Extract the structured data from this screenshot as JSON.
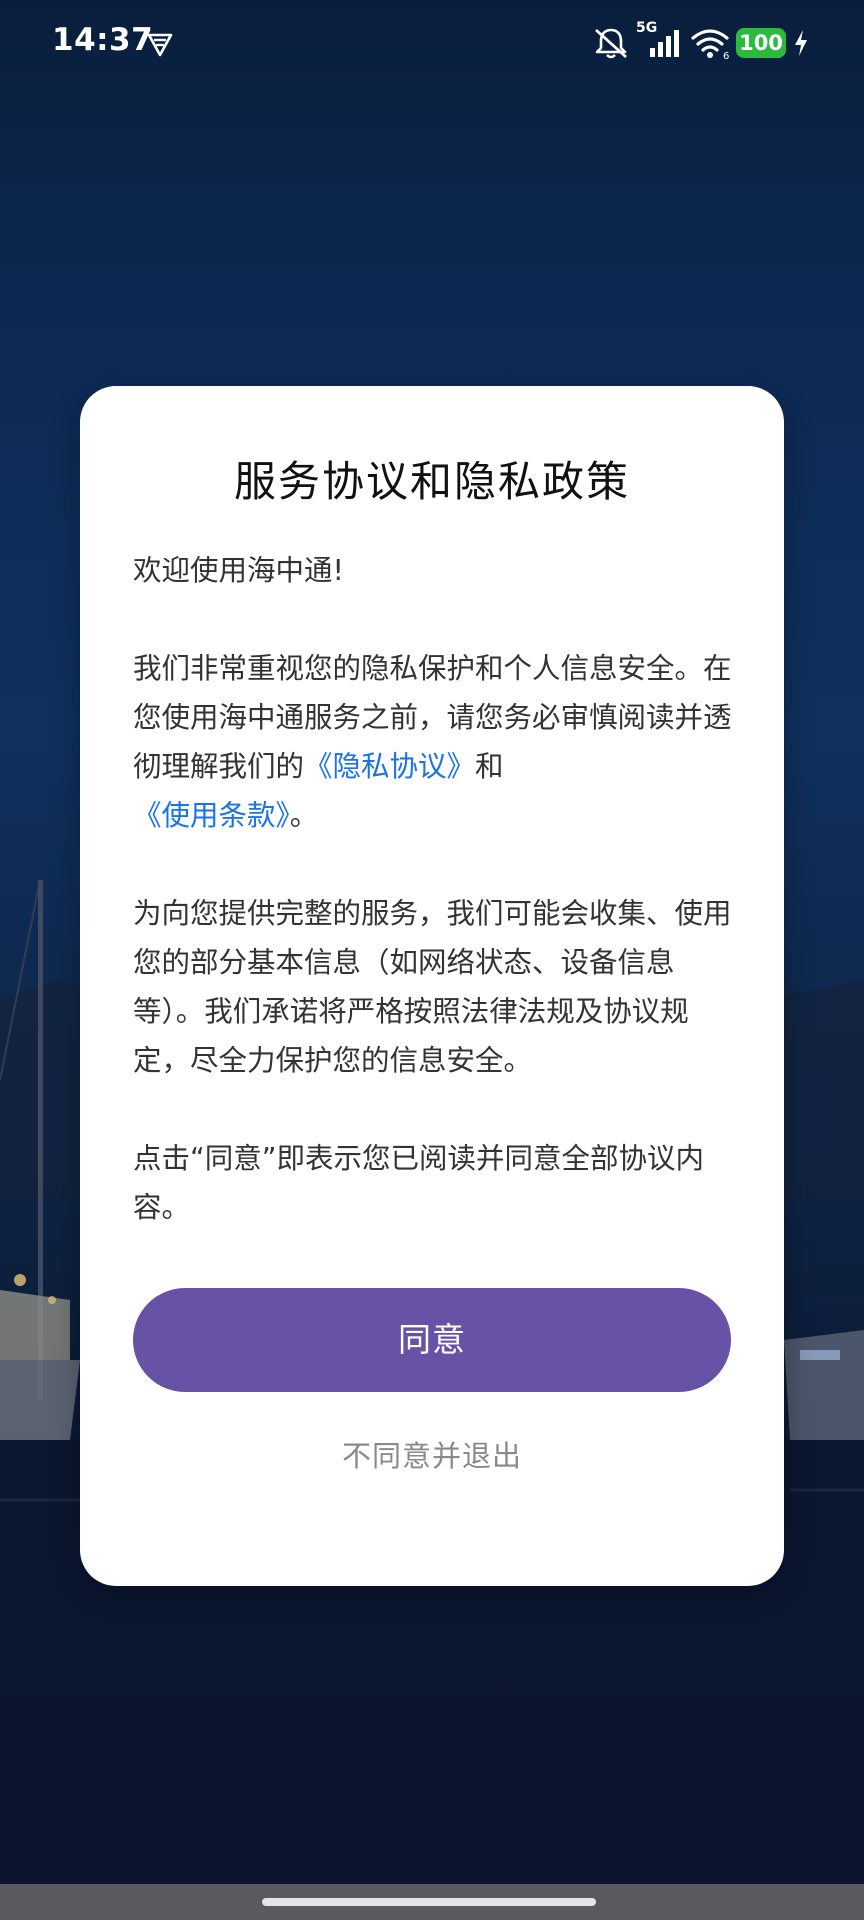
{
  "status_bar": {
    "time": "14:37",
    "network_type": "5G",
    "battery_level": "100",
    "icons": [
      "vpn-shield-icon",
      "mute-bell-icon",
      "signal-icon",
      "wifi-icon",
      "charging-icon"
    ]
  },
  "dialog": {
    "title": "服务协议和隐私政策",
    "welcome": "欢迎使用海中通!",
    "para1_pre": "我们非常重视您的隐私保护和个人信息安全。在您使用海中通服务之前，请您务必审慎阅读并透彻理解我们的",
    "privacy_link": "《隐私协议》",
    "para1_mid": "和",
    "terms_link": "《使用条款》",
    "para1_end": "。",
    "para2": "为向您提供完整的服务，我们可能会收集、使用您的部分基本信息（如网络状态、设备信息等）。我们承诺将严格按照法律法规及协议规定，尽全力保护您的信息安全。",
    "para3": "点击“同意”即表示您已阅读并同意全部协议内容。",
    "agree_label": "同意",
    "decline_label": "不同意并退出"
  },
  "colors": {
    "accent": "#6752a6",
    "link": "#1a73e8",
    "battery": "#2bb93e"
  }
}
